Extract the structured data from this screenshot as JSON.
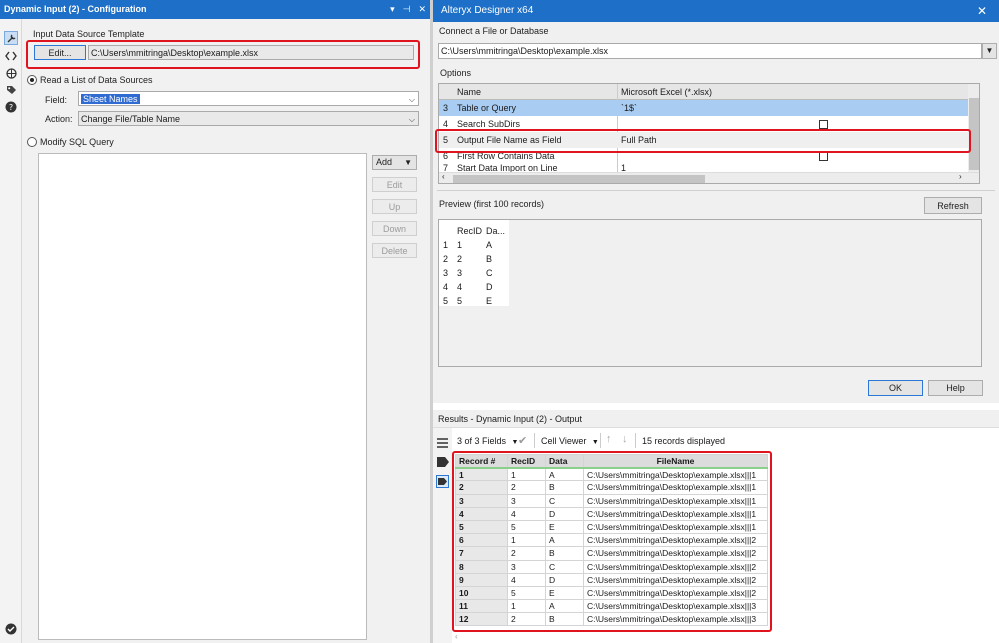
{
  "left_panel": {
    "title": "Dynamic Input (2) - Configuration",
    "title_controls": [
      "▾",
      "⊣",
      "✕"
    ],
    "template_label": "Input Data Source Template",
    "edit_button": "Edit...",
    "template_path": "C:\\Users\\mmitringa\\Desktop\\example.xlsx",
    "read_list_label": "Read a List of Data Sources",
    "field_label": "Field:",
    "field_value": "Sheet Names",
    "action_label": "Action:",
    "action_value": "Change File/Table Name",
    "modify_sql_label": "Modify SQL Query",
    "side_buttons": {
      "add": "Add",
      "edit": "Edit",
      "up": "Up",
      "down": "Down",
      "delete": "Delete"
    },
    "rail_icons": [
      "wrench-icon",
      "code-icon",
      "globe-icon",
      "tag-icon",
      "help-icon"
    ]
  },
  "dialog": {
    "title": "Alteryx Designer x64",
    "connect_label": "Connect a File or Database",
    "connect_value": "C:\\Users\\mmitringa\\Desktop\\example.xlsx",
    "options_label": "Options",
    "options_headers": [
      "Name",
      "Microsoft Excel (*.xlsx)"
    ],
    "options_rows": [
      {
        "num": "3",
        "name": "Table or Query",
        "value": "`1$`",
        "selected": true
      },
      {
        "num": "4",
        "name": "Search SubDirs",
        "value": "",
        "checkbox": true
      },
      {
        "num": "5",
        "name": "Output File Name as Field",
        "value": "Full Path"
      },
      {
        "num": "6",
        "name": "First Row Contains Data",
        "value": "",
        "checkbox": true
      },
      {
        "num": "7",
        "name": "Start Data Import on Line",
        "value": "1"
      }
    ],
    "preview_label": "Preview (first 100 records)",
    "refresh_button": "Refresh",
    "preview_headers": [
      "RecID",
      "Da..."
    ],
    "preview_rows": [
      [
        "1",
        "1",
        "A"
      ],
      [
        "2",
        "2",
        "B"
      ],
      [
        "3",
        "3",
        "C"
      ],
      [
        "4",
        "4",
        "D"
      ],
      [
        "5",
        "5",
        "E"
      ]
    ],
    "ok_button": "OK",
    "help_button": "Help"
  },
  "results": {
    "title": "Results - Dynamic Input (2) - Output",
    "fields_label": "3 of 3 Fields",
    "cell_viewer": "Cell Viewer",
    "records_label": "15 records displayed",
    "headers": [
      "Record #",
      "RecID",
      "Data",
      "FileName"
    ],
    "rows": [
      [
        "1",
        "1",
        "A",
        "C:\\Users\\mmitringa\\Desktop\\example.xlsx|||1"
      ],
      [
        "2",
        "2",
        "B",
        "C:\\Users\\mmitringa\\Desktop\\example.xlsx|||1"
      ],
      [
        "3",
        "3",
        "C",
        "C:\\Users\\mmitringa\\Desktop\\example.xlsx|||1"
      ],
      [
        "4",
        "4",
        "D",
        "C:\\Users\\mmitringa\\Desktop\\example.xlsx|||1"
      ],
      [
        "5",
        "5",
        "E",
        "C:\\Users\\mmitringa\\Desktop\\example.xlsx|||1"
      ],
      [
        "6",
        "1",
        "A",
        "C:\\Users\\mmitringa\\Desktop\\example.xlsx|||2"
      ],
      [
        "7",
        "2",
        "B",
        "C:\\Users\\mmitringa\\Desktop\\example.xlsx|||2"
      ],
      [
        "8",
        "3",
        "C",
        "C:\\Users\\mmitringa\\Desktop\\example.xlsx|||2"
      ],
      [
        "9",
        "4",
        "D",
        "C:\\Users\\mmitringa\\Desktop\\example.xlsx|||2"
      ],
      [
        "10",
        "5",
        "E",
        "C:\\Users\\mmitringa\\Desktop\\example.xlsx|||2"
      ],
      [
        "11",
        "1",
        "A",
        "C:\\Users\\mmitringa\\Desktop\\example.xlsx|||3"
      ],
      [
        "12",
        "2",
        "B",
        "C:\\Users\\mmitringa\\Desktop\\example.xlsx|||3"
      ]
    ]
  },
  "colors": {
    "title_bar": "#1d6fc7",
    "highlight_box": "#e0141e",
    "selected_row": "#a9cdf2"
  }
}
